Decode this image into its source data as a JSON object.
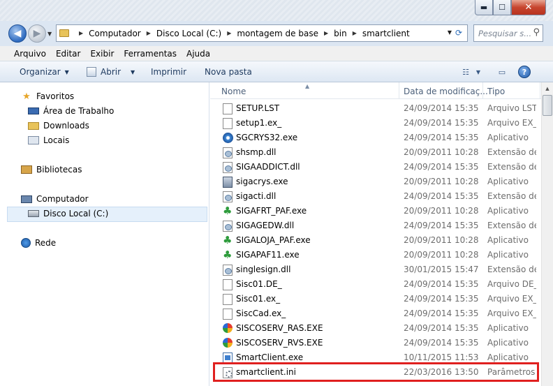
{
  "window": {
    "minimize": "▬",
    "maximize": "☐",
    "close": "✕"
  },
  "address": {
    "back": "◀",
    "forward": "▶",
    "breadcrumbs": [
      "Computador",
      "Disco Local (C:)",
      "montagem de base",
      "bin",
      "smartclient"
    ],
    "search_placeholder": "Pesquisar s..."
  },
  "menu": [
    "Arquivo",
    "Editar",
    "Exibir",
    "Ferramentas",
    "Ajuda"
  ],
  "commands": {
    "organize": "Organizar",
    "open": "Abrir",
    "print": "Imprimir",
    "new_folder": "Nova pasta",
    "help": "?"
  },
  "nav": {
    "favorites": "Favoritos",
    "desktop": "Área de Trabalho",
    "downloads": "Downloads",
    "places": "Locais",
    "libraries": "Bibliotecas",
    "computer": "Computador",
    "local_disk": "Disco Local (C:)",
    "network": "Rede"
  },
  "columns": {
    "name": "Nome",
    "date": "Data de modificaç...",
    "type": "Tipo"
  },
  "files": [
    {
      "name": "SETUP.LST",
      "date": "24/09/2014 15:35",
      "type": "Arquivo LST",
      "icon": "doc"
    },
    {
      "name": "setup1.ex_",
      "date": "24/09/2014 15:35",
      "type": "Arquivo EX_",
      "icon": "doc"
    },
    {
      "name": "SGCRYS32.exe",
      "date": "24/09/2014 15:35",
      "type": "Aplicativo",
      "icon": "cd"
    },
    {
      "name": "shsmp.dll",
      "date": "20/09/2011 10:28",
      "type": "Extensão de",
      "icon": "dll"
    },
    {
      "name": "SIGAADDICT.dll",
      "date": "24/09/2014 15:35",
      "type": "Extensão de",
      "icon": "dll"
    },
    {
      "name": "sigacrys.exe",
      "date": "20/09/2011 10:28",
      "type": "Aplicativo",
      "icon": "app"
    },
    {
      "name": "sigacti.dll",
      "date": "24/09/2014 15:35",
      "type": "Extensão de",
      "icon": "dll"
    },
    {
      "name": "SIGAFRT_PAF.exe",
      "date": "20/09/2011 10:28",
      "type": "Aplicativo",
      "icon": "palm"
    },
    {
      "name": "SIGAGEDW.dll",
      "date": "24/09/2014 15:35",
      "type": "Extensão de",
      "icon": "dll"
    },
    {
      "name": "SIGALOJA_PAF.exe",
      "date": "20/09/2011 10:28",
      "type": "Aplicativo",
      "icon": "palm"
    },
    {
      "name": "SIGAPAF11.exe",
      "date": "20/09/2011 10:28",
      "type": "Aplicativo",
      "icon": "palm"
    },
    {
      "name": "singlesign.dll",
      "date": "30/01/2015 15:47",
      "type": "Extensão de",
      "icon": "dll"
    },
    {
      "name": "Sisc01.DE_",
      "date": "24/09/2014 15:35",
      "type": "Arquivo DE_",
      "icon": "doc"
    },
    {
      "name": "Sisc01.ex_",
      "date": "24/09/2014 15:35",
      "type": "Arquivo EX_",
      "icon": "doc"
    },
    {
      "name": "SiscCad.ex_",
      "date": "24/09/2014 15:35",
      "type": "Arquivo EX_",
      "icon": "doc"
    },
    {
      "name": "SISCOSERV_RAS.EXE",
      "date": "24/09/2014 15:35",
      "type": "Aplicativo",
      "icon": "flower"
    },
    {
      "name": "SISCOSERV_RVS.EXE",
      "date": "24/09/2014 15:35",
      "type": "Aplicativo",
      "icon": "flower"
    },
    {
      "name": "SmartClient.exe",
      "date": "10/11/2015 11:53",
      "type": "Aplicativo",
      "icon": "scr"
    },
    {
      "name": "smartclient.ini",
      "date": "22/03/2016 13:50",
      "type": "Parâmetros d",
      "icon": "gear"
    }
  ],
  "highlight_color": "#e0201f"
}
